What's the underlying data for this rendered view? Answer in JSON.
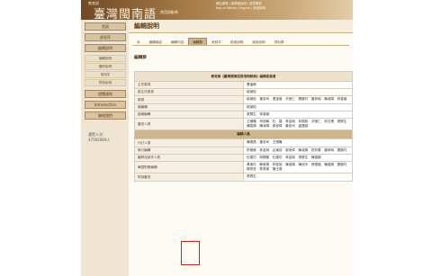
{
  "banner": {
    "title_sub": "教育部",
    "title": "臺灣閩南語",
    "title_en": "常用詞辭典",
    "nav": [
      "網站導覽 | 無障礙說明 | 常見問答",
      "Bag of Words | English | 使用說明"
    ]
  },
  "sidebar": {
    "items": [
      "首頁",
      "部長序",
      "編輯說明"
    ],
    "sub_items": [
      "編輯說明",
      "體例說明",
      "常用字",
      "附錄說明"
    ],
    "items_lower": [
      "相關連結",
      "Introduction",
      "聯絡我們"
    ],
    "visits_label": "瀏覽人次：",
    "visits_count": "47502084人"
  },
  "main": {
    "page_title": "編輯說明",
    "tabs": [
      "序",
      "編輯緣起",
      "編輯內容",
      "編輯群",
      "收錄字",
      "檢索說明",
      "使用說明",
      "資料庫"
    ],
    "active_tab_index": 3,
    "section_heading": "編輯群",
    "table_caption": "教育部《臺灣閩南語常用詞辭典》編輯委員會",
    "rows": [
      {
        "role": "主任委員",
        "names": "曹逢甫"
      },
      {
        "role": "副主任委員",
        "names": "姚榮松"
      },
      {
        "role": "委員",
        "names": "姚榮松　董忠司　連金發　洪惟仁　蕭藤村　董恭瑞　陳淑娟　林香薇"
      },
      {
        "role": "總編輯",
        "names": "姚榮松"
      },
      {
        "role": "副總編輯",
        "names": "張屏生　林香薇"
      },
      {
        "role": "審查人員",
        "names": "王順隆　何信翰　杜　建　林金城　林慶勳　洪惟仁　邱文錫　張屏生　陳嘉順　陳淑娟　鄭良偉　董忠司　盧廣誠"
      }
    ],
    "staff_heading": "編輯人員",
    "staff_rows": [
      {
        "role": "代訂人員",
        "names": "陳德昌　董忠司　王順隆"
      },
      {
        "role": "執行編輯",
        "names": "許極燉　林金城　呂東成　鄭良偉　陳淑娟　許彩雲　董恭瑞　蕭藤村"
      },
      {
        "role": "編詞及製作人員",
        "names": "杜建坊　邱錦樹　杜建坊　林金城　張屏生　陳嘉順"
      },
      {
        "role": "華語對照編輯",
        "names": "黃惠玲　賴惠德　林俊旭　陳淑娟　陳冠宇　張德福　陳嘉順　蕭藤村　楊秀芳　蔡秀菊　陳玉鶯"
      },
      {
        "role": "附錄審查",
        "names": "張屏生"
      }
    ]
  }
}
